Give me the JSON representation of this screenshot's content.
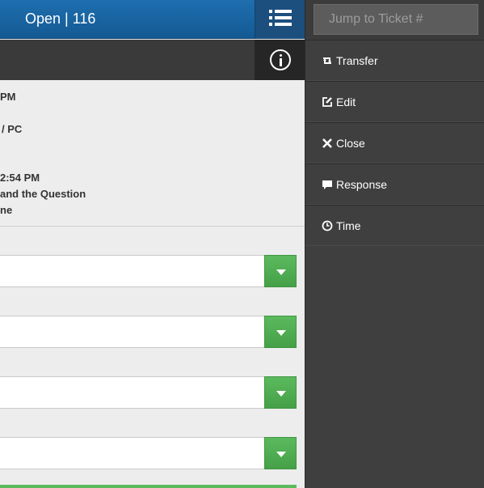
{
  "header": {
    "title": "Open | 116"
  },
  "icons": {
    "menu": "list-icon",
    "info": "info-icon",
    "dropdown": "chevron-down-icon"
  },
  "details": [
    "PM",
    "/ PC",
    "2:54 PM",
    "and the Question",
    "ne"
  ],
  "dropdowns": [
    {
      "value": ""
    },
    {
      "value": ""
    },
    {
      "value": ""
    },
    {
      "value": ""
    }
  ],
  "panel": {
    "jump_placeholder": "Jump to Ticket #",
    "actions": [
      {
        "label": "Transfer",
        "icon": "retweet-icon"
      },
      {
        "label": "Edit",
        "icon": "edit-icon"
      },
      {
        "label": "Close",
        "icon": "close-icon"
      },
      {
        "label": "Response",
        "icon": "comment-icon"
      },
      {
        "label": "Time",
        "icon": "clock-icon"
      }
    ]
  },
  "colors": {
    "header_blue": "#1a66a6",
    "accent_green": "#52b155",
    "panel_dark": "#3f3f3f"
  }
}
